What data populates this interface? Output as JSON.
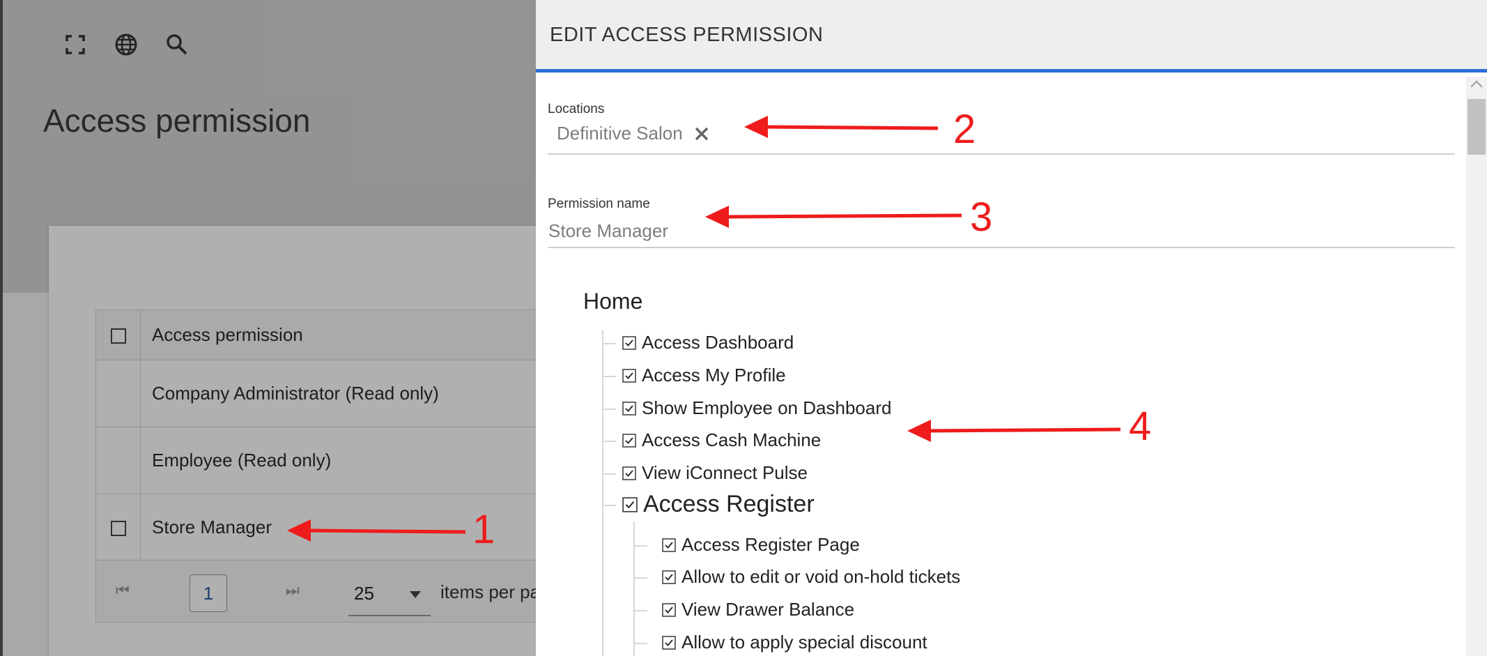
{
  "toolbar": {
    "icons": [
      "fullscreen-icon",
      "globe-icon",
      "search-icon"
    ]
  },
  "page": {
    "title": "Access permission"
  },
  "grid": {
    "header": "Access permission",
    "rows": [
      "Company Administrator (Read only)",
      "Employee (Read only)",
      "Store Manager"
    ]
  },
  "pager": {
    "current_page": "1",
    "page_size": "25",
    "info": "items per page"
  },
  "dialog": {
    "title": "EDIT ACCESS PERMISSION",
    "locations_label": "Locations",
    "location_chip": "Definitive Salon",
    "permission_name_label": "Permission name",
    "permission_name_value": "Store Manager",
    "tree": {
      "root": "Home",
      "items": [
        "Access Dashboard",
        "Access My Profile",
        "Show Employee on Dashboard",
        "Access Cash Machine",
        "View iConnect Pulse"
      ],
      "group": {
        "label": "Access Register",
        "children": [
          "Access Register Page",
          "Allow to edit or void on-hold tickets",
          "View Drawer Balance",
          "Allow to apply special discount"
        ]
      }
    }
  },
  "annotations": [
    "1",
    "2",
    "3",
    "4"
  ],
  "colors": {
    "accent": "#2a6fd8",
    "annotation": "#ee1c1c",
    "overlay": "rgba(0,0,0,0.31)"
  }
}
